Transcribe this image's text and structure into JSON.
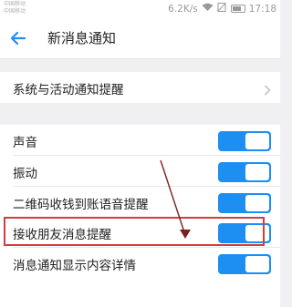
{
  "status_bar": {
    "carrier_line1": "中国移动",
    "carrier_line2": "中国移动",
    "net_speed": "6.2K/s",
    "battery_icon": "battery-icon",
    "wifi_icon": "wifi-icon",
    "time": "17:18"
  },
  "header": {
    "back_icon": "back-arrow-icon",
    "title": "新消息通知"
  },
  "sections": {
    "system": {
      "label": "系统与活动通知提醒"
    },
    "sound": {
      "label": "声音",
      "enabled": true
    },
    "vibrate": {
      "label": "振动",
      "enabled": true
    },
    "qr": {
      "label": "二维码收钱到账语音提醒",
      "enabled": true
    },
    "friend_msg": {
      "label": "接收朋友消息提醒",
      "enabled": true
    },
    "detail": {
      "label": "消息通知显示内容详情",
      "enabled": true
    }
  },
  "colors": {
    "toggle_on": "#1e8ff2",
    "accent": "#1e8ff2",
    "annotation": "#d43c3c",
    "arrow": "#7a1f1f"
  }
}
